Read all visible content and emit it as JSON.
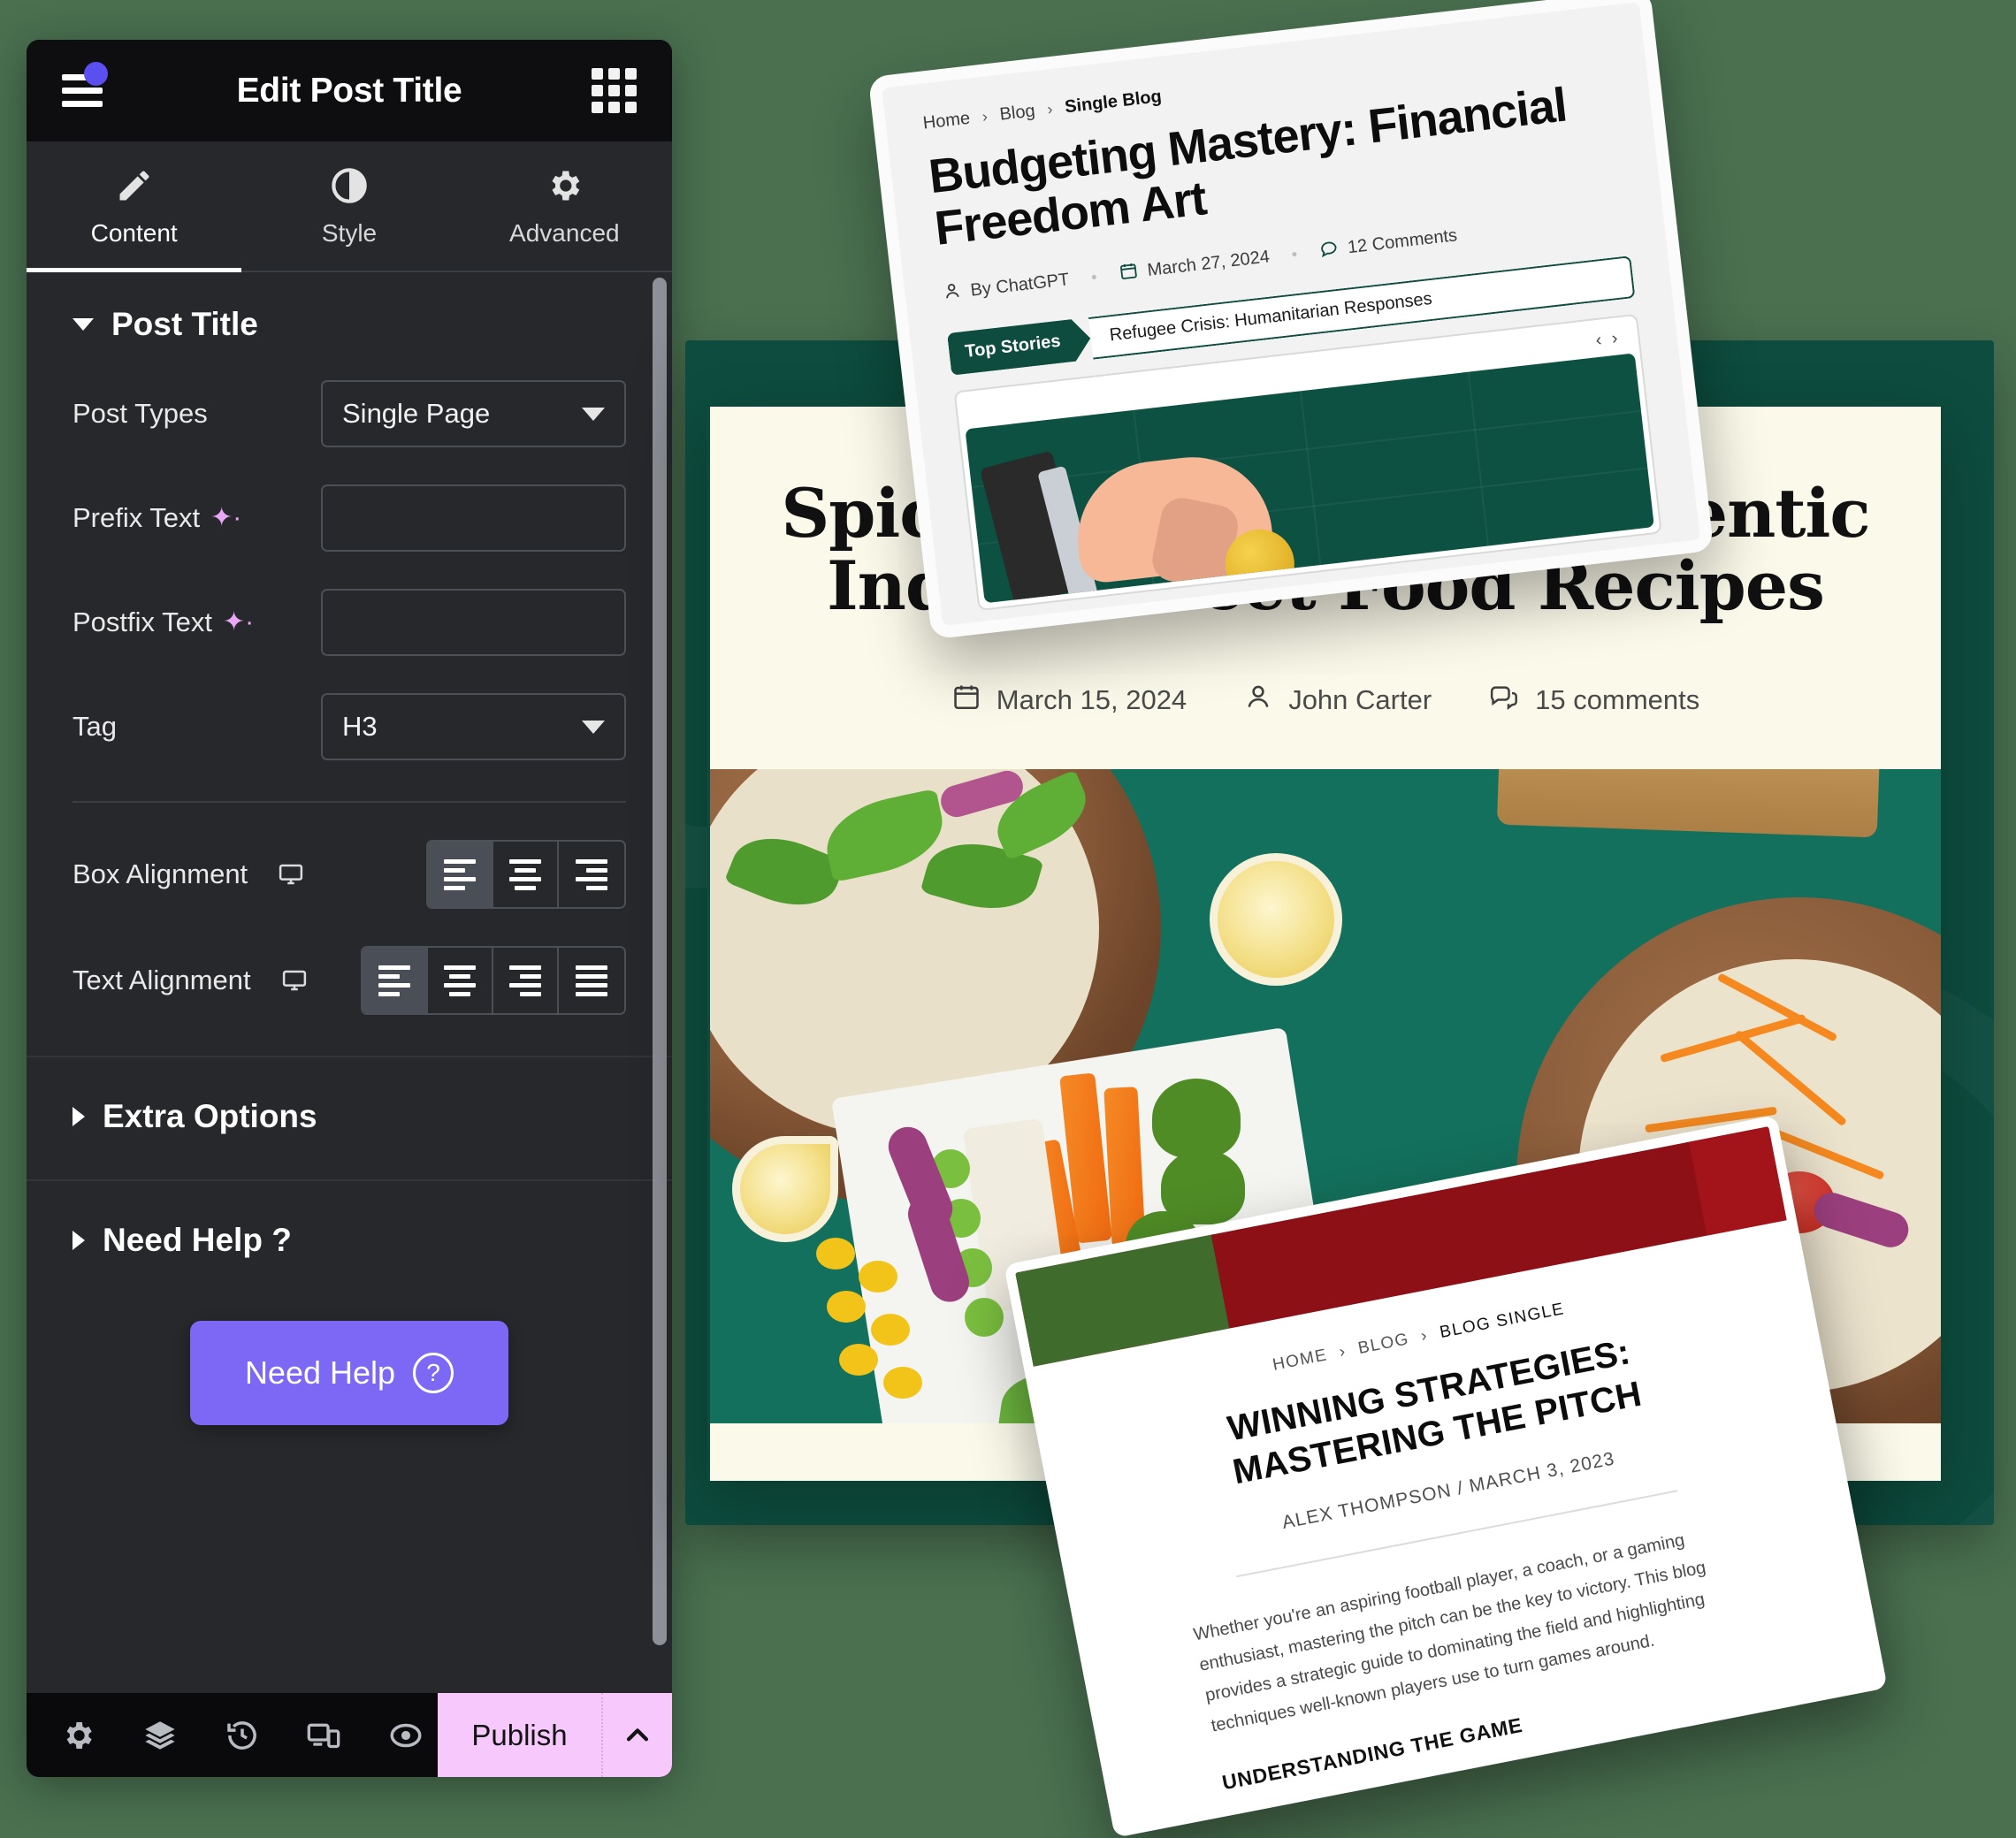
{
  "panel": {
    "header": {
      "title": "Edit Post Title",
      "menu_icon": "hamburger-icon",
      "apps_icon": "grid-apps-icon"
    },
    "tabs": [
      {
        "label": "Content",
        "icon": "pencil-icon",
        "active": true
      },
      {
        "label": "Style",
        "icon": "contrast-icon",
        "active": false
      },
      {
        "label": "Advanced",
        "icon": "gear-icon",
        "active": false
      }
    ],
    "sections": [
      {
        "label": "Post Title",
        "expanded": true
      },
      {
        "label": "Extra Options",
        "expanded": false
      },
      {
        "label": "Need Help ?",
        "expanded": false
      }
    ],
    "fields": {
      "post_types": {
        "label": "Post Types",
        "value": "Single Page",
        "options": [
          "Single Page"
        ]
      },
      "prefix_text": {
        "label": "Prefix Text",
        "value": "",
        "placeholder": "",
        "ai_icon": "sparkle-icon",
        "dynamic_icon": "database-icon"
      },
      "postfix_text": {
        "label": "Postfix Text",
        "value": "",
        "placeholder": "",
        "ai_icon": "sparkle-icon",
        "dynamic_icon": "database-icon"
      },
      "tag": {
        "label": "Tag",
        "value": "H3",
        "options": [
          "H3"
        ]
      },
      "box_alignment": {
        "label": "Box Alignment",
        "device_icon": "desktop-icon",
        "options": [
          "left",
          "center",
          "right"
        ],
        "selected": "left"
      },
      "text_alignment": {
        "label": "Text Alignment",
        "device_icon": "desktop-icon",
        "options": [
          "left",
          "center",
          "right",
          "justify"
        ],
        "selected": "left"
      }
    },
    "cta": {
      "label": "Need Help",
      "icon": "question-circle-icon"
    },
    "footer": {
      "icons": [
        "gear-icon",
        "layers-icon",
        "history-icon",
        "responsive-icon",
        "preview-eye-icon"
      ],
      "publish_label": "Publish",
      "publish_caret": "chevron-up-icon"
    },
    "colors": {
      "accent": "#7d68f5",
      "publish_bg": "#f6c8fb",
      "panel_bg": "#26282c",
      "header_bg": "#0e0e10",
      "notification_dot": "#5b4ff0"
    }
  },
  "canvas": {
    "background_color": "#4a7050",
    "backdrop_color": "#0d4c3e",
    "main_card": {
      "background_color": "#fbf9e9",
      "title": "Spice Up Your Life: Authentic Indian Street Food Recipes",
      "meta": [
        {
          "icon": "calendar-icon",
          "text": "March 15, 2024"
        },
        {
          "icon": "user-icon",
          "text": "John Carter"
        },
        {
          "icon": "comments-icon",
          "text": "15 comments"
        }
      ],
      "image_alt": "indian-street-food-photo"
    },
    "budget_card": {
      "breadcrumbs": [
        "Home",
        "Blog",
        "Single Blog"
      ],
      "title": "Budgeting Mastery: Financial Freedom Art",
      "meta": [
        {
          "icon": "user-icon",
          "text": "By ChatGPT"
        },
        {
          "icon": "calendar-icon",
          "text": "March 27, 2024"
        },
        {
          "icon": "comment-icon",
          "text": "12 Comments"
        }
      ],
      "ticker_tag": "Top Stories",
      "ticker_text": "Refugee Crisis: Humanitarian Responses",
      "slider_nav": "‹ ›",
      "accent_color": "#0d4c3e"
    },
    "winning_card": {
      "breadcrumbs": [
        "HOME",
        "BLOG",
        "BLOG SINGLE"
      ],
      "title": "WINNING STRATEGIES: MASTERING THE PITCH",
      "byline": "ALEX THOMPSON / MARCH 3, 2023",
      "paragraph": "Whether you're an aspiring football player, a coach, or a gaming enthusiast, mastering the pitch can be the key to victory. This blog provides a strategic guide to dominating the field and highlighting techniques well-known players use to turn games around.",
      "subheading": "UNDERSTANDING THE GAME",
      "accent_color": "#8c1015"
    }
  }
}
